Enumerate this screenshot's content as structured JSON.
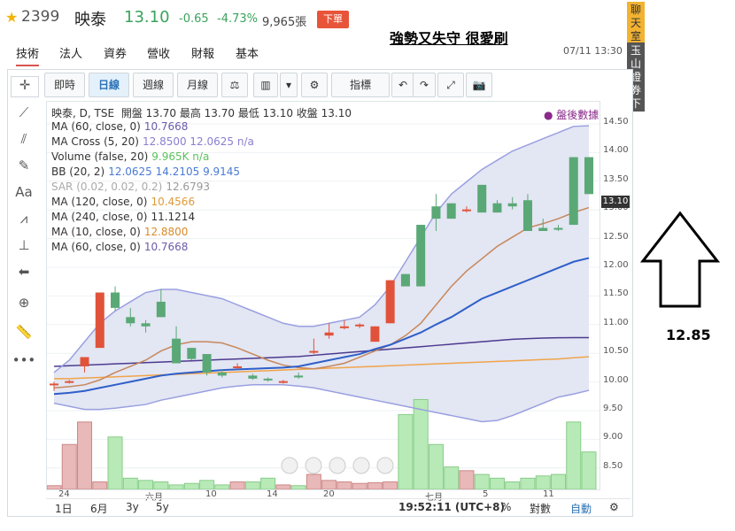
{
  "stock": {
    "code": "2399",
    "name": "映泰",
    "price": "13.10",
    "change": "-0.65",
    "change_pct": "-4.73%",
    "volume": "9,965張",
    "order": "下單"
  },
  "annotation": {
    "title": "強勢又失守 很愛刷",
    "value": "12.85"
  },
  "nav": {
    "tabs": [
      "技術",
      "法人",
      "資券",
      "營收",
      "財報",
      "基本"
    ]
  },
  "datetime": "07/11 13:30",
  "side": {
    "chat": "聊天室",
    "broker": "玉山證券下單"
  },
  "toolbar": {
    "items": [
      "即時",
      "日線",
      "週線",
      "月線",
      "⚖",
      "▥",
      "▾",
      "⚙",
      "指標",
      "↶",
      "↷",
      "⤢",
      "📷"
    ]
  },
  "legend": [
    {
      "label": "映泰, D, TSE",
      "values": "開盤 13.70 最高 13.70 最低 13.10 收盤 13.10"
    },
    {
      "label": "MA (60, close, 0)",
      "values": "10.7668",
      "color": "#6b5ba8"
    },
    {
      "label": "MA Cross (5, 20)",
      "values": "12.8500 12.0625 n/a",
      "color": "#8a7fd0"
    },
    {
      "label": "Volume (false, 20)",
      "values": "9.965K n/a",
      "color": "#7ad97a"
    },
    {
      "label": "BB (20, 2)",
      "values": "12.0625 14.2105 9.9145",
      "color": "#4a7ad6"
    },
    {
      "label": "SAR (0.02, 0.02, 0.2)",
      "values": "12.6793",
      "color": "#bbbbbb"
    },
    {
      "label": "MA (120, close, 0)",
      "values": "10.4566",
      "color": "#e09a3a"
    },
    {
      "label": "MA (240, close, 0)",
      "values": "11.1214",
      "color": "#555555"
    },
    {
      "label": "MA (10, close, 0)",
      "values": "12.8800",
      "color": "#d98a2a"
    },
    {
      "label": "MA (60, close, 0)",
      "values": "10.7668",
      "color": "#6b5ba8"
    }
  ],
  "after_hours": "盤後數據",
  "price_tag": "13.10",
  "y_ticks": [
    "14.50",
    "14.00",
    "13.50",
    "13.00",
    "12.50",
    "12.00",
    "11.50",
    "11.00",
    "10.50",
    "10.00",
    "9.50",
    "9.00",
    "8.50"
  ],
  "x_ticks": [
    "24",
    "六月",
    "10",
    "14",
    "20",
    "七月",
    "5",
    "11"
  ],
  "bottom": {
    "ranges": [
      "1日",
      "6月",
      "3y",
      "5y"
    ],
    "clock": "19:52:11 (UTC+8)",
    "pct": "%",
    "log": "對數",
    "auto": "自動"
  },
  "chart_data": {
    "type": "candlestick",
    "ylim": [
      8.3,
      14.6
    ],
    "candles": [
      [
        10.0,
        10.05,
        9.9,
        10.02
      ],
      [
        10.05,
        10.08,
        10.02,
        10.06
      ],
      [
        10.3,
        10.45,
        10.2,
        10.45
      ],
      [
        10.6,
        11.5,
        10.6,
        11.5
      ],
      [
        11.5,
        11.6,
        11.2,
        11.25
      ],
      [
        11.1,
        11.25,
        10.95,
        11.0
      ],
      [
        11.0,
        11.05,
        10.85,
        10.95
      ],
      [
        11.35,
        11.55,
        11.1,
        11.1
      ],
      [
        10.75,
        10.95,
        10.35,
        10.35
      ],
      [
        10.6,
        10.6,
        10.4,
        10.42
      ],
      [
        10.5,
        10.5,
        10.15,
        10.2
      ],
      [
        10.2,
        10.25,
        10.12,
        10.15
      ],
      [
        10.3,
        10.35,
        10.25,
        10.3
      ],
      [
        10.15,
        10.18,
        10.08,
        10.1
      ],
      [
        10.1,
        10.12,
        10.05,
        10.08
      ],
      [
        10.05,
        10.08,
        10.02,
        10.06
      ],
      [
        10.15,
        10.2,
        10.1,
        10.12
      ],
      [
        10.55,
        10.75,
        10.5,
        10.55
      ],
      [
        10.8,
        11.0,
        10.75,
        10.85
      ],
      [
        10.92,
        11.05,
        10.9,
        10.95
      ],
      [
        10.95,
        11.0,
        10.92,
        10.98
      ],
      [
        10.7,
        10.95,
        10.7,
        10.95
      ],
      [
        11.0,
        11.7,
        11.0,
        11.7
      ],
      [
        11.8,
        11.8,
        11.6,
        11.6
      ],
      [
        12.6,
        12.6,
        11.6,
        11.6
      ],
      [
        12.9,
        13.1,
        12.5,
        12.7
      ],
      [
        12.95,
        12.95,
        12.7,
        12.7
      ],
      [
        12.85,
        12.9,
        12.8,
        12.85
      ],
      [
        13.25,
        13.25,
        12.8,
        12.8
      ],
      [
        12.95,
        13.0,
        12.8,
        12.8
      ],
      [
        12.95,
        13.05,
        12.85,
        12.9
      ],
      [
        13.0,
        13.1,
        12.5,
        12.5
      ],
      [
        12.55,
        12.7,
        12.5,
        12.5
      ],
      [
        12.55,
        12.6,
        12.5,
        12.52
      ],
      [
        13.7,
        13.7,
        12.6,
        12.6
      ],
      [
        13.7,
        13.7,
        13.1,
        13.1
      ]
    ],
    "volume": [
      5,
      60,
      90,
      10,
      70,
      15,
      12,
      10,
      6,
      8,
      12,
      6,
      10,
      10,
      15,
      6,
      5,
      20,
      12,
      10,
      8,
      9,
      10,
      100,
      120,
      60,
      30,
      25,
      20,
      15,
      10,
      15,
      18,
      20,
      90,
      50
    ],
    "series": [
      {
        "name": "MA (60, close, 0)",
        "values": [
          10.3,
          10.31,
          10.32,
          10.33,
          10.34,
          10.35,
          10.36,
          10.37,
          10.38,
          10.39,
          10.4,
          10.41,
          10.42,
          10.43,
          10.44,
          10.45,
          10.46,
          10.48,
          10.5,
          10.52,
          10.54,
          10.56,
          10.58,
          10.6,
          10.62,
          10.64,
          10.66,
          10.68,
          10.7,
          10.72,
          10.74,
          10.75,
          10.76,
          10.765,
          10.766,
          10.7668
        ]
      },
      {
        "name": "MA (120, close, 0)",
        "values": [
          10.1,
          10.1,
          10.11,
          10.12,
          10.13,
          10.14,
          10.15,
          10.16,
          10.17,
          10.18,
          10.19,
          10.2,
          10.21,
          10.22,
          10.23,
          10.24,
          10.25,
          10.26,
          10.27,
          10.28,
          10.29,
          10.3,
          10.31,
          10.32,
          10.33,
          10.34,
          10.35,
          10.36,
          10.37,
          10.38,
          10.39,
          10.4,
          10.41,
          10.42,
          10.44,
          10.4566
        ]
      },
      {
        "name": "MA (10, close, 0)",
        "values": [
          9.95,
          9.97,
          10.0,
          10.08,
          10.2,
          10.3,
          10.4,
          10.55,
          10.65,
          10.7,
          10.7,
          10.68,
          10.6,
          10.5,
          10.4,
          10.32,
          10.28,
          10.26,
          10.3,
          10.35,
          10.45,
          10.55,
          10.65,
          10.8,
          11.0,
          11.3,
          11.6,
          11.85,
          12.05,
          12.25,
          12.4,
          12.55,
          12.62,
          12.7,
          12.8,
          12.88
        ]
      },
      {
        "name": "BB upper",
        "values": [
          10.2,
          10.4,
          10.7,
          11.0,
          11.2,
          11.35,
          11.5,
          11.55,
          11.55,
          11.5,
          11.45,
          11.4,
          11.3,
          11.2,
          11.1,
          11.0,
          10.95,
          10.95,
          11.0,
          11.05,
          11.1,
          11.3,
          11.6,
          12.0,
          12.4,
          12.8,
          13.1,
          13.3,
          13.5,
          13.65,
          13.8,
          13.9,
          14.0,
          14.1,
          14.2,
          14.21
        ]
      },
      {
        "name": "BB lower",
        "values": [
          9.7,
          9.65,
          9.6,
          9.6,
          9.62,
          9.65,
          9.68,
          9.75,
          9.8,
          9.85,
          9.9,
          9.95,
          9.98,
          10.0,
          10.0,
          10.0,
          9.98,
          9.95,
          9.9,
          9.85,
          9.8,
          9.75,
          9.7,
          9.65,
          9.6,
          9.55,
          9.5,
          9.45,
          9.4,
          9.42,
          9.5,
          9.6,
          9.7,
          9.8,
          9.85,
          9.91
        ]
      },
      {
        "name": "BB mid",
        "values": [
          9.85,
          9.87,
          9.9,
          9.95,
          10.0,
          10.05,
          10.1,
          10.15,
          10.18,
          10.2,
          10.22,
          10.24,
          10.25,
          10.26,
          10.27,
          10.28,
          10.3,
          10.35,
          10.4,
          10.45,
          10.5,
          10.58,
          10.65,
          10.75,
          10.85,
          10.98,
          11.1,
          11.25,
          11.4,
          11.5,
          11.6,
          11.7,
          11.8,
          11.9,
          12.0,
          12.06
        ]
      }
    ]
  }
}
